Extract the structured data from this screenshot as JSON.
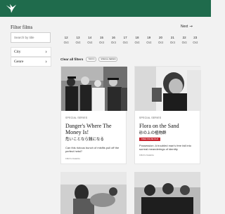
{
  "header": {
    "logo_icon": "bird-logo-icon",
    "background": "#1f6b4c"
  },
  "sidebar": {
    "title": "Filter films",
    "search_placeholder": "Search by title",
    "filters": [
      {
        "label": "City"
      },
      {
        "label": "Genre"
      }
    ]
  },
  "nav": {
    "next_label": "Next",
    "next_icon": "arrow-right-icon"
  },
  "dates": [
    {
      "day": "12",
      "month": "Oct"
    },
    {
      "day": "13",
      "month": "Oct"
    },
    {
      "day": "14",
      "month": "Oct"
    },
    {
      "day": "15",
      "month": "Oct"
    },
    {
      "day": "16",
      "month": "Oct"
    },
    {
      "day": "17",
      "month": "Oct"
    },
    {
      "day": "18",
      "month": "Oct"
    },
    {
      "day": "19",
      "month": "Oct"
    },
    {
      "day": "20",
      "month": "Oct"
    },
    {
      "day": "21",
      "month": "Oct"
    },
    {
      "day": "22",
      "month": "Oct"
    },
    {
      "day": "23",
      "month": "Oct"
    }
  ],
  "active_filters": {
    "clear_label": "Clear all filters",
    "pills": [
      "TOKYO",
      "SPECIAL SERIES"
    ]
  },
  "cards": [
    {
      "series": "SPECIAL SERIES",
      "title": "Danger's Where The Money Is!",
      "title_jp": "危いことなら銭になる",
      "desc": "Can this riotous bunch of misfits pull off the perfect heist?",
      "credit": "1962 Ko Nakahira"
    },
    {
      "series": "SPECIAL SERIES",
      "title": "Flora on the Sand",
      "title_jp": "砂の上の植物群",
      "badge": "FREE ONLINE FILM",
      "desc": "Possession: A troubled man's free fall into surreal meanderings of identity",
      "credit": "1964 Ko Nakahira"
    }
  ]
}
